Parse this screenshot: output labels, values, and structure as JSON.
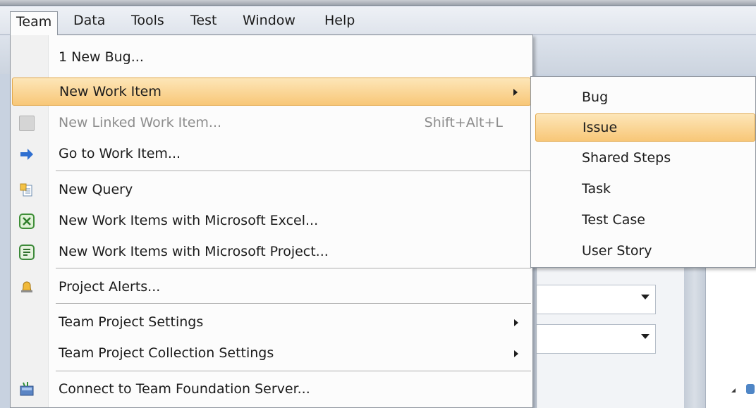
{
  "menubar": {
    "items": [
      {
        "label": "Team",
        "open": true
      },
      {
        "label": "Data"
      },
      {
        "label": "Tools"
      },
      {
        "label": "Test"
      },
      {
        "label": "Window"
      },
      {
        "label": "Help"
      }
    ]
  },
  "team_menu": {
    "items": [
      {
        "label": "1 New Bug..."
      },
      {
        "label": "New Work Item",
        "submenu": true,
        "highlighted": true
      },
      {
        "label": "New Linked Work Item...",
        "shortcut": "Shift+Alt+L",
        "disabled": true,
        "icon": "linked-work-item-icon"
      },
      {
        "label": "Go to Work Item...",
        "icon": "arrow-right-icon"
      },
      {
        "label": "New Query",
        "icon": "new-query-icon"
      },
      {
        "label": "New Work Items with Microsoft Excel...",
        "icon": "excel-icon"
      },
      {
        "label": "New Work Items with Microsoft Project...",
        "icon": "project-icon"
      },
      {
        "label": "Project Alerts...",
        "icon": "bell-icon"
      },
      {
        "label": "Team Project Settings",
        "submenu": true
      },
      {
        "label": "Team Project Collection Settings",
        "submenu": true
      },
      {
        "label": "Connect to Team Foundation Server...",
        "icon": "server-icon"
      }
    ]
  },
  "work_item_submenu": {
    "items": [
      {
        "label": "Bug"
      },
      {
        "label": "Issue",
        "highlighted": true
      },
      {
        "label": "Shared Steps"
      },
      {
        "label": "Task"
      },
      {
        "label": "Test Case"
      },
      {
        "label": "User Story"
      }
    ]
  },
  "colors": {
    "highlight_top": "#fde6b8",
    "highlight_bottom": "#f8c778",
    "highlight_border": "#e2a748",
    "menu_background": "#fcfcfc",
    "disabled_text": "#8d8d8d"
  }
}
